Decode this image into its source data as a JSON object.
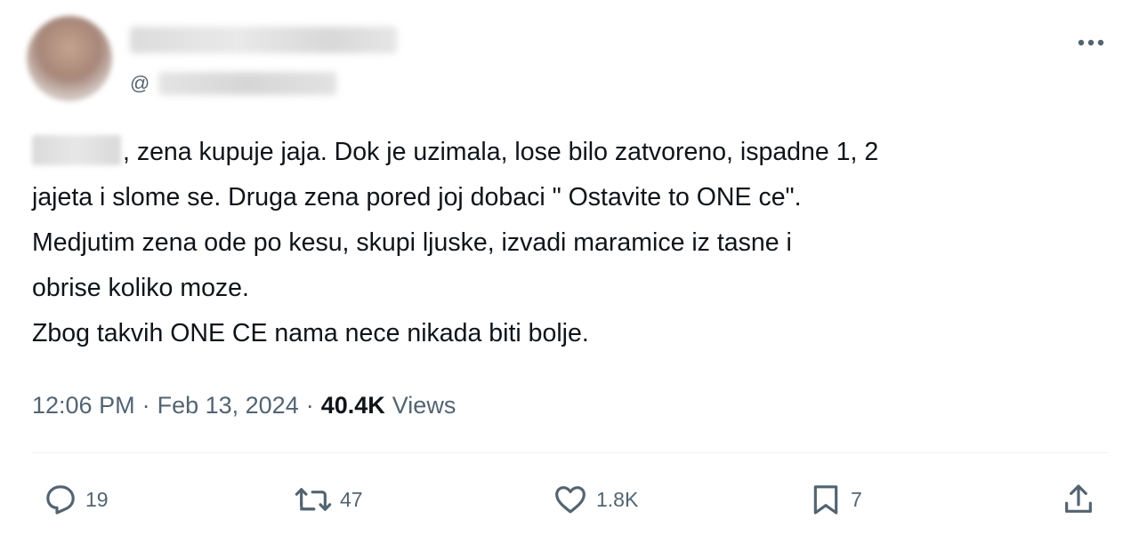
{
  "header": {
    "handle_prefix": "@"
  },
  "post": {
    "text_line1": ", zena kupuje jaja. Dok je uzimala, lose bilo zatvoreno, ispadne 1, 2",
    "text_rest": "jajeta i slome se. Druga zena pored joj dobaci \" Ostavite to ONE ce\".\nMedjutim zena ode po kesu, skupi ljuske, izvadi maramice iz tasne i\nobrise koliko moze.\nZbog takvih ONE CE nama nece nikada biti bolje."
  },
  "meta": {
    "time": "12:06 PM",
    "separator": "·",
    "date": "Feb 13, 2024",
    "views_count": "40.4K",
    "views_label": "Views"
  },
  "actions": {
    "replies": "19",
    "reposts": "47",
    "likes": "1.8K",
    "bookmarks": "7"
  },
  "icons": {
    "more": "more-horizontal-icon",
    "reply": "reply-bubble-icon",
    "repost": "repost-arrows-icon",
    "like": "heart-icon",
    "bookmark": "bookmark-icon",
    "share": "share-upload-icon"
  },
  "colors": {
    "text": "#0f1419",
    "secondary": "#536471",
    "divider": "#eff3f4"
  }
}
